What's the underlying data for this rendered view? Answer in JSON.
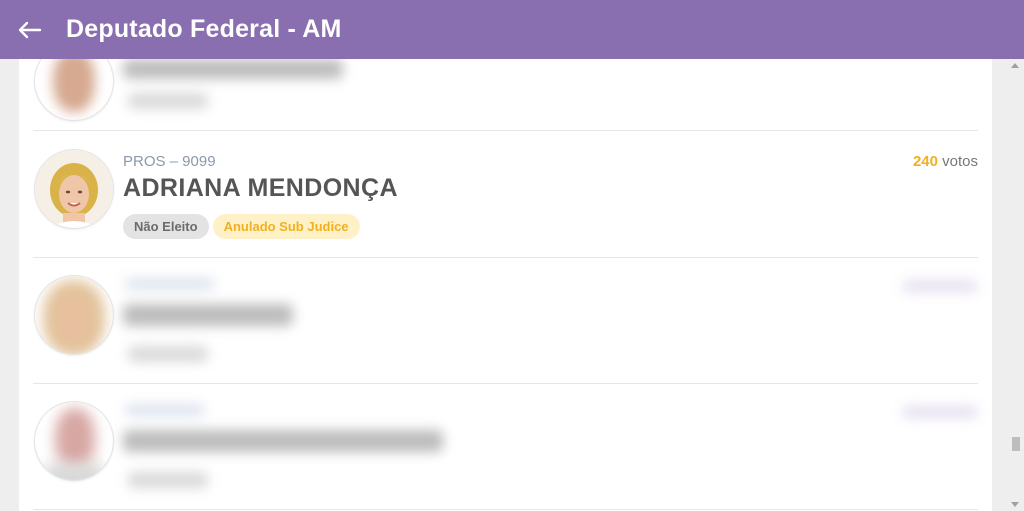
{
  "header": {
    "title": "Deputado Federal - AM",
    "back_icon": "arrow-left-icon"
  },
  "candidates": [
    {
      "party_number": "PROS – 9099",
      "name": "ADRIANA MENDONÇA",
      "votes_count": "240",
      "votes_label": "votos",
      "status_tag": "Não Eleito",
      "legal_tag": "Anulado Sub Judice"
    }
  ],
  "colors": {
    "header_bg": "#8a6fb0",
    "votes_accent": "#f2b01e",
    "tag_yellow_bg": "#fff1c7",
    "tag_gray_bg": "#e3e3e3"
  }
}
